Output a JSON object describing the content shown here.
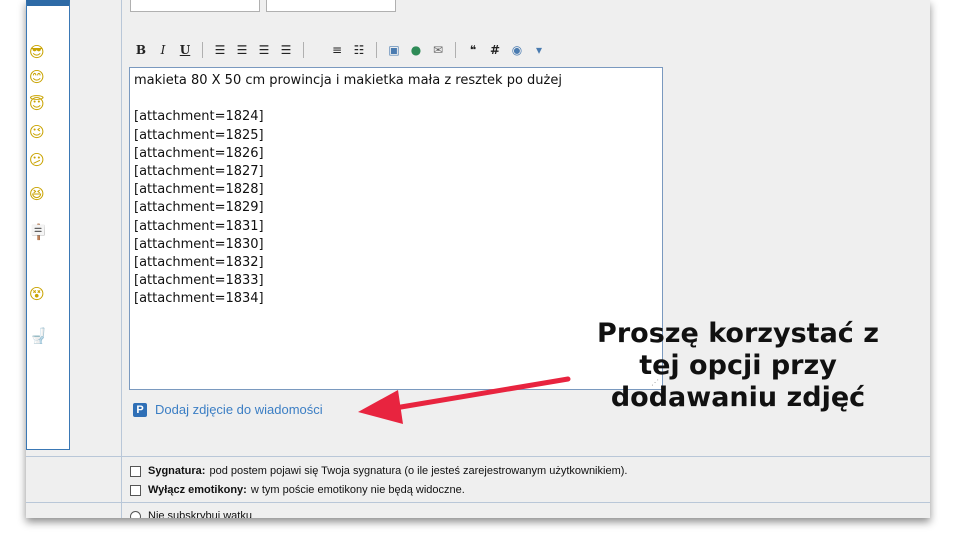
{
  "toolbar": {
    "bold_label": "B",
    "italic_label": "I",
    "underline_label": "U"
  },
  "editor": {
    "lines": [
      "makieta 80 X 50 cm prowincja i makietka mała z resztek po dużej",
      "",
      "[attachment=1824]",
      "[attachment=1825]",
      "[attachment=1826]",
      "[attachment=1827]",
      "[attachment=1828]",
      "[attachment=1829]",
      "[attachment=1831]",
      "[attachment=1830]",
      "[attachment=1832]",
      "[attachment=1833]",
      "[attachment=1834]"
    ]
  },
  "add_photo": {
    "icon_letter": "P",
    "label": "Dodaj zdjęcie do wiadomości"
  },
  "options": {
    "signature_label": "Sygnatura:",
    "signature_text": "pod postem pojawi się Twoja sygnatura (o ile jesteś zarejestrowanym użytkownikiem).",
    "disable_emoticons_label": "Wyłącz emotikony:",
    "disable_emoticons_text": "w tym poście emotikony nie będą widoczne.",
    "subscribe_text": "Nie subskrybuj wątku"
  },
  "annotation": {
    "lines": [
      "Proszę korzystać z",
      "tej opcji przy",
      "dodawaniu zdjęć"
    ],
    "arrow_color": "#e8243f"
  }
}
